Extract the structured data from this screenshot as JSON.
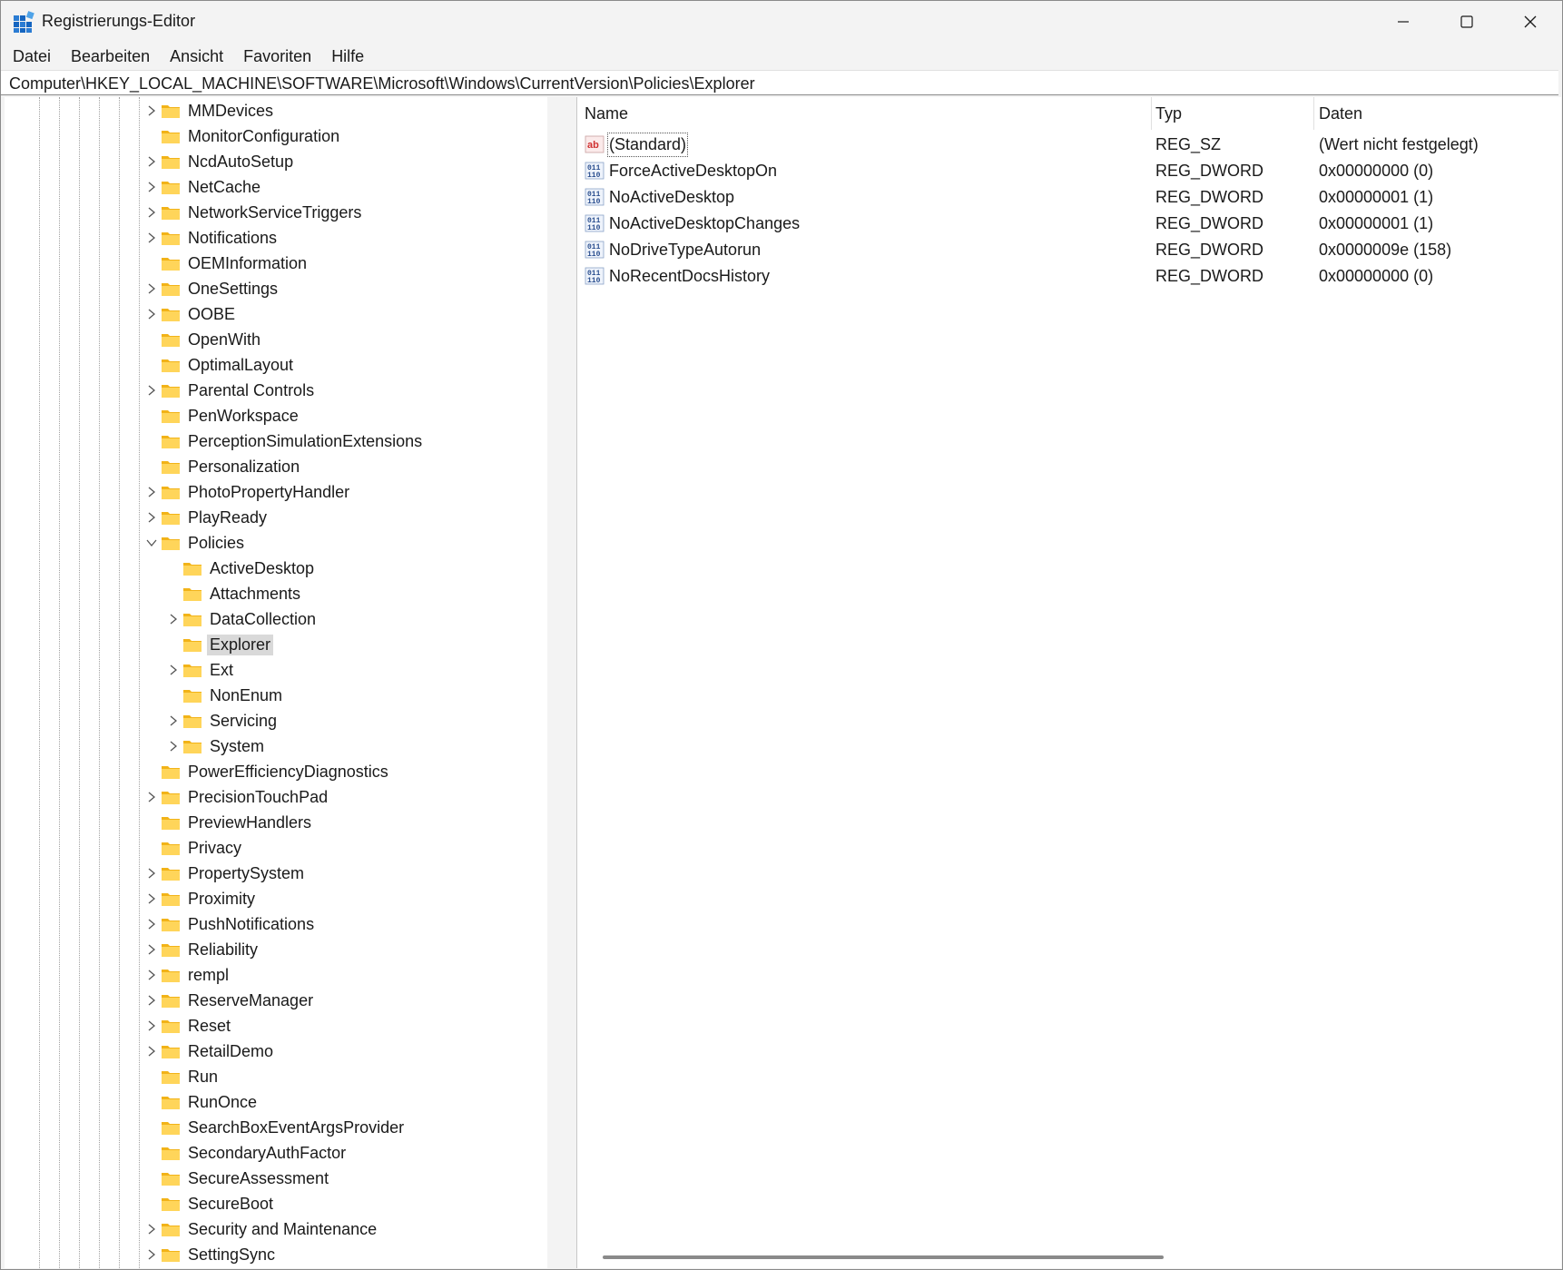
{
  "window": {
    "title": "Registrierungs-Editor",
    "controls": [
      "minimize-icon",
      "maximize-icon",
      "close-icon"
    ]
  },
  "menu": [
    "Datei",
    "Bearbeiten",
    "Ansicht",
    "Favoriten",
    "Hilfe"
  ],
  "address": "Computer\\HKEY_LOCAL_MACHINE\\SOFTWARE\\Microsoft\\Windows\\CurrentVersion\\Policies\\Explorer",
  "tree": [
    {
      "label": "MMDevices",
      "level": 1,
      "expandable": true
    },
    {
      "label": "MonitorConfiguration",
      "level": 1,
      "expandable": false
    },
    {
      "label": "NcdAutoSetup",
      "level": 1,
      "expandable": true
    },
    {
      "label": "NetCache",
      "level": 1,
      "expandable": true
    },
    {
      "label": "NetworkServiceTriggers",
      "level": 1,
      "expandable": true
    },
    {
      "label": "Notifications",
      "level": 1,
      "expandable": true
    },
    {
      "label": "OEMInformation",
      "level": 1,
      "expandable": false
    },
    {
      "label": "OneSettings",
      "level": 1,
      "expandable": true
    },
    {
      "label": "OOBE",
      "level": 1,
      "expandable": true
    },
    {
      "label": "OpenWith",
      "level": 1,
      "expandable": false
    },
    {
      "label": "OptimalLayout",
      "level": 1,
      "expandable": false
    },
    {
      "label": "Parental Controls",
      "level": 1,
      "expandable": true
    },
    {
      "label": "PenWorkspace",
      "level": 1,
      "expandable": false
    },
    {
      "label": "PerceptionSimulationExtensions",
      "level": 1,
      "expandable": false
    },
    {
      "label": "Personalization",
      "level": 1,
      "expandable": false
    },
    {
      "label": "PhotoPropertyHandler",
      "level": 1,
      "expandable": true
    },
    {
      "label": "PlayReady",
      "level": 1,
      "expandable": true
    },
    {
      "label": "Policies",
      "level": 1,
      "expandable": true,
      "expanded": true
    },
    {
      "label": "ActiveDesktop",
      "level": 2,
      "expandable": false
    },
    {
      "label": "Attachments",
      "level": 2,
      "expandable": false
    },
    {
      "label": "DataCollection",
      "level": 2,
      "expandable": true
    },
    {
      "label": "Explorer",
      "level": 2,
      "expandable": false,
      "selected": true
    },
    {
      "label": "Ext",
      "level": 2,
      "expandable": true
    },
    {
      "label": "NonEnum",
      "level": 2,
      "expandable": false
    },
    {
      "label": "Servicing",
      "level": 2,
      "expandable": true
    },
    {
      "label": "System",
      "level": 2,
      "expandable": true
    },
    {
      "label": "PowerEfficiencyDiagnostics",
      "level": 1,
      "expandable": false
    },
    {
      "label": "PrecisionTouchPad",
      "level": 1,
      "expandable": true
    },
    {
      "label": "PreviewHandlers",
      "level": 1,
      "expandable": false
    },
    {
      "label": "Privacy",
      "level": 1,
      "expandable": false
    },
    {
      "label": "PropertySystem",
      "level": 1,
      "expandable": true
    },
    {
      "label": "Proximity",
      "level": 1,
      "expandable": true
    },
    {
      "label": "PushNotifications",
      "level": 1,
      "expandable": true
    },
    {
      "label": "Reliability",
      "level": 1,
      "expandable": true
    },
    {
      "label": "rempl",
      "level": 1,
      "expandable": true
    },
    {
      "label": "ReserveManager",
      "level": 1,
      "expandable": true
    },
    {
      "label": "Reset",
      "level": 1,
      "expandable": true
    },
    {
      "label": "RetailDemo",
      "level": 1,
      "expandable": true
    },
    {
      "label": "Run",
      "level": 1,
      "expandable": false
    },
    {
      "label": "RunOnce",
      "level": 1,
      "expandable": false
    },
    {
      "label": "SearchBoxEventArgsProvider",
      "level": 1,
      "expandable": false
    },
    {
      "label": "SecondaryAuthFactor",
      "level": 1,
      "expandable": false
    },
    {
      "label": "SecureAssessment",
      "level": 1,
      "expandable": false
    },
    {
      "label": "SecureBoot",
      "level": 1,
      "expandable": false
    },
    {
      "label": "Security and Maintenance",
      "level": 1,
      "expandable": true
    },
    {
      "label": "SettingSync",
      "level": 1,
      "expandable": true
    }
  ],
  "list": {
    "columns": [
      "Name",
      "Typ",
      "Daten"
    ],
    "rows": [
      {
        "name": "(Standard)",
        "type": "REG_SZ",
        "data": "(Wert nicht festgelegt)",
        "icon": "string-value-icon"
      },
      {
        "name": "ForceActiveDesktopOn",
        "type": "REG_DWORD",
        "data": "0x00000000 (0)",
        "icon": "binary-value-icon"
      },
      {
        "name": "NoActiveDesktop",
        "type": "REG_DWORD",
        "data": "0x00000001 (1)",
        "icon": "binary-value-icon"
      },
      {
        "name": "NoActiveDesktopChanges",
        "type": "REG_DWORD",
        "data": "0x00000001 (1)",
        "icon": "binary-value-icon"
      },
      {
        "name": "NoDriveTypeAutorun",
        "type": "REG_DWORD",
        "data": "0x0000009e (158)",
        "icon": "binary-value-icon"
      },
      {
        "name": "NoRecentDocsHistory",
        "type": "REG_DWORD",
        "data": "0x00000000 (0)",
        "icon": "binary-value-icon"
      }
    ]
  }
}
